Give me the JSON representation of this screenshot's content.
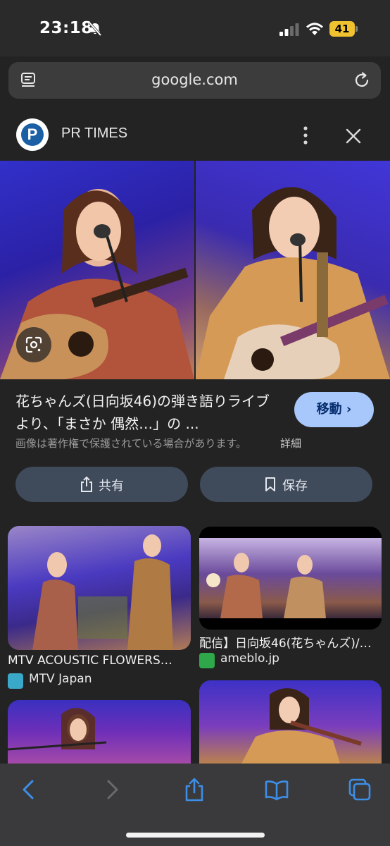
{
  "status_bar": {
    "time": "23:18",
    "battery": "41",
    "battery_color": "#f1c22f"
  },
  "browser": {
    "url": "google.com"
  },
  "result_header": {
    "source": "PR TIMES",
    "logo_letter": "P"
  },
  "result": {
    "title": "花ちゃんズ(日向坂46)の弾き語りライブより、「まさか 偶然…」の ...",
    "go_button": "移動 ›",
    "copyright_notice": "画像は著作権で保護されている場合があります。",
    "details_link": "詳細",
    "share_button": "共有",
    "save_button": "保存"
  },
  "related": [
    {
      "title": "MTV ACOUSTIC FLOWERS…",
      "source": "MTV Japan"
    },
    {
      "title": "配信】日向坂46(花ちゃんズ)/…",
      "source": "ameblo.jp"
    }
  ],
  "colors": {
    "accent_button": "#a8c7fa",
    "action_button": "#3f4a5a",
    "toolbar_icon": "#3d8ee6"
  }
}
